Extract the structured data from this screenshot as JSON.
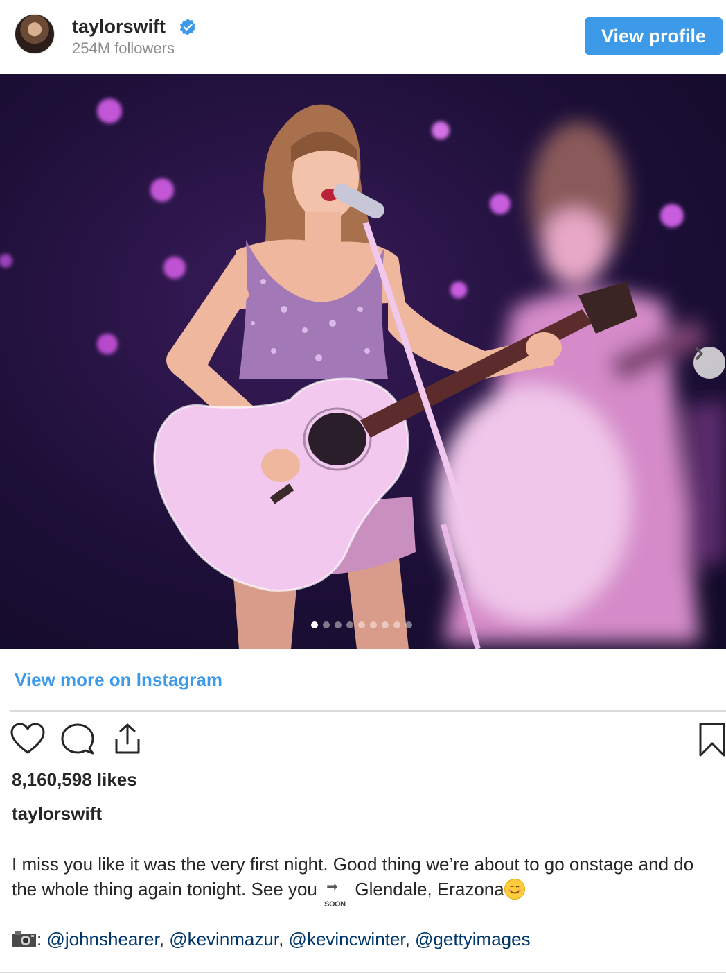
{
  "header": {
    "username": "taylorswift",
    "followers": "254M followers",
    "view_profile_label": "View profile",
    "verified_icon": "verified-badge-icon"
  },
  "media": {
    "carousel_dots_total": 9,
    "carousel_active_index": 0,
    "next_icon": "chevron-right-icon"
  },
  "footer": {
    "view_more_label": "View more on Instagram",
    "likes": "8,160,598 likes",
    "caption_user": "taylorswift",
    "caption_text_1": "I miss you like it was the very first night. Good thing we’re about to go onstage and do the whole thing again tonight. See you",
    "soon_label": "SOON",
    "caption_text_2": "Glendale, Erazona",
    "credits_prefix": ": ",
    "mentions": [
      "@johnshearer",
      "@kevinmazur",
      "@kevincwinter",
      "@gettyimages"
    ],
    "separator": ", "
  },
  "colors": {
    "accent": "#3d9ae8",
    "mention": "#00376b",
    "muted": "#8e8e8e"
  }
}
